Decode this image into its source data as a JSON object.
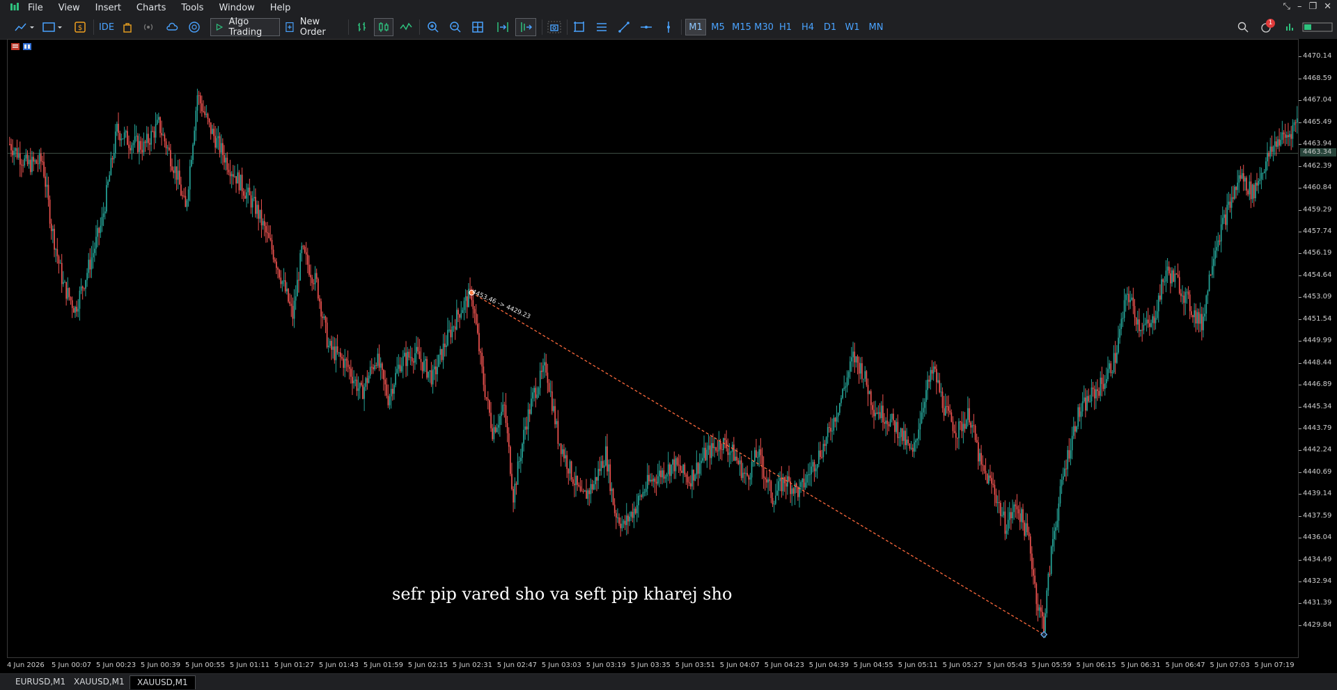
{
  "menu": {
    "items": [
      "File",
      "View",
      "Insert",
      "Charts",
      "Tools",
      "Window",
      "Help"
    ]
  },
  "toolbar": {
    "ide_label": "IDE",
    "algo_trading_label": "Algo Trading",
    "new_order_label": "New Order",
    "timeframes": [
      "M1",
      "M5",
      "M15",
      "M30",
      "H1",
      "H4",
      "D1",
      "W1",
      "MN"
    ],
    "active_timeframe": "M1",
    "notification_count": "1"
  },
  "chart": {
    "symbol": "XAUUSD",
    "timeframe": "M1",
    "annotation": "sefr pip vared sho va seft pip kharej sho",
    "trendline_label": "4453.46 -> 4429.23",
    "current_price_label": "4463.34",
    "price_ticks": [
      "4470.14",
      "4468.59",
      "4467.04",
      "4465.49",
      "4463.94",
      "4462.39",
      "4460.84",
      "4459.29",
      "4457.74",
      "4456.19",
      "4454.64",
      "4453.09",
      "4451.54",
      "4449.99",
      "4448.44",
      "4446.89",
      "4445.34",
      "4443.79",
      "4442.24",
      "4440.69",
      "4439.14",
      "4437.59",
      "4436.04",
      "4434.49",
      "4432.94",
      "4431.39",
      "4429.84"
    ],
    "time_ticks": [
      "4 Jun 2026",
      "5 Jun 00:07",
      "5 Jun 00:23",
      "5 Jun 00:39",
      "5 Jun 00:55",
      "5 Jun 01:11",
      "5 Jun 01:27",
      "5 Jun 01:43",
      "5 Jun 01:59",
      "5 Jun 02:15",
      "5 Jun 02:31",
      "5 Jun 02:47",
      "5 Jun 03:03",
      "5 Jun 03:19",
      "5 Jun 03:35",
      "5 Jun 03:51",
      "5 Jun 04:07",
      "5 Jun 04:23",
      "5 Jun 04:39",
      "5 Jun 04:55",
      "5 Jun 05:11",
      "5 Jun 05:27",
      "5 Jun 05:43",
      "5 Jun 05:59",
      "5 Jun 06:15",
      "5 Jun 06:31",
      "5 Jun 06:47",
      "5 Jun 07:03",
      "5 Jun 07:19"
    ],
    "colors": {
      "bull": "#26a69a",
      "bear": "#ef5350",
      "trendline": "#ff6a3d",
      "price_line": "#4a5a50"
    }
  },
  "chart_data": {
    "type": "candlestick",
    "ylim": [
      4428.9,
      4471.0
    ],
    "current_price": 4463.34,
    "close_path": [
      [
        0,
        4464.0
      ],
      [
        12,
        4462.5
      ],
      [
        22,
        4462.8
      ],
      [
        28,
        4458.2
      ],
      [
        36,
        4454.0
      ],
      [
        44,
        4452.3
      ],
      [
        54,
        4455.6
      ],
      [
        62,
        4458.5
      ],
      [
        72,
        4465.0
      ],
      [
        80,
        4464.2
      ],
      [
        90,
        4463.8
      ],
      [
        100,
        4465.4
      ],
      [
        112,
        4461.9
      ],
      [
        118,
        4459.3
      ],
      [
        126,
        4467.5
      ],
      [
        134,
        4465.2
      ],
      [
        146,
        4462.7
      ],
      [
        156,
        4461.0
      ],
      [
        166,
        4459.3
      ],
      [
        178,
        4456.0
      ],
      [
        190,
        4451.8
      ],
      [
        196,
        4456.4
      ],
      [
        206,
        4454.1
      ],
      [
        214,
        4449.6
      ],
      [
        226,
        4448.4
      ],
      [
        236,
        4446.3
      ],
      [
        246,
        4448.9
      ],
      [
        254,
        4446.0
      ],
      [
        262,
        4448.5
      ],
      [
        272,
        4449.2
      ],
      [
        284,
        4447.4
      ],
      [
        292,
        4449.8
      ],
      [
        302,
        4452.2
      ],
      [
        310,
        4453.4
      ],
      [
        318,
        4447.1
      ],
      [
        324,
        4443.7
      ],
      [
        332,
        4445.3
      ],
      [
        338,
        4439.1
      ],
      [
        346,
        4444.0
      ],
      [
        352,
        4446.4
      ],
      [
        360,
        4448.2
      ],
      [
        368,
        4443.2
      ],
      [
        376,
        4440.9
      ],
      [
        384,
        4438.8
      ],
      [
        392,
        4439.9
      ],
      [
        400,
        4442.1
      ],
      [
        406,
        4438.0
      ],
      [
        412,
        4436.9
      ],
      [
        420,
        4438.3
      ],
      [
        428,
        4439.9
      ],
      [
        436,
        4440.6
      ],
      [
        446,
        4441.3
      ],
      [
        456,
        4440.2
      ],
      [
        466,
        4441.9
      ],
      [
        478,
        4442.9
      ],
      [
        486,
        4442.0
      ],
      [
        494,
        4440.3
      ],
      [
        502,
        4442.1
      ],
      [
        512,
        4438.9
      ],
      [
        520,
        4440.2
      ],
      [
        530,
        4439.3
      ],
      [
        538,
        4441.0
      ],
      [
        548,
        4443.0
      ],
      [
        558,
        4446.0
      ],
      [
        566,
        4448.9
      ],
      [
        572,
        4448.0
      ],
      [
        580,
        4445.3
      ],
      [
        588,
        4444.7
      ],
      [
        596,
        4443.8
      ],
      [
        606,
        4441.9
      ],
      [
        614,
        4446.2
      ],
      [
        620,
        4448.0
      ],
      [
        628,
        4445.0
      ],
      [
        636,
        4443.6
      ],
      [
        644,
        4444.9
      ],
      [
        652,
        4441.0
      ],
      [
        660,
        4439.7
      ],
      [
        668,
        4437.0
      ],
      [
        676,
        4438.4
      ],
      [
        684,
        4435.9
      ],
      [
        690,
        4431.2
      ],
      [
        694,
        4430.0
      ],
      [
        700,
        4436.0
      ],
      [
        708,
        4441.0
      ],
      [
        716,
        4444.6
      ],
      [
        724,
        4445.9
      ],
      [
        734,
        4447.1
      ],
      [
        742,
        4448.9
      ],
      [
        750,
        4453.5
      ],
      [
        758,
        4451.2
      ],
      [
        766,
        4451.0
      ],
      [
        776,
        4455.0
      ],
      [
        784,
        4454.2
      ],
      [
        792,
        4452.5
      ],
      [
        800,
        4451.2
      ],
      [
        808,
        4456.5
      ],
      [
        818,
        4459.5
      ],
      [
        826,
        4461.8
      ],
      [
        834,
        4460.5
      ],
      [
        842,
        4462.5
      ],
      [
        850,
        4464.2
      ],
      [
        858,
        4464.6
      ],
      [
        866,
        4466.1
      ]
    ],
    "trendline": {
      "start": [
        310,
        4453.46
      ],
      "end": [
        694,
        4429.23
      ]
    }
  }
}
